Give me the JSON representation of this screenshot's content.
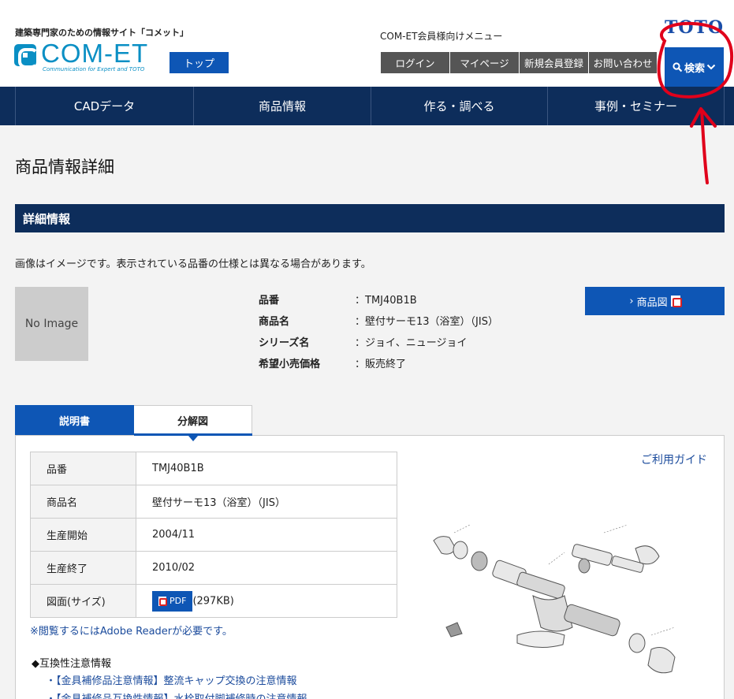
{
  "header": {
    "tagline": "建築専門家のための情報サイト「コメット」",
    "logo_text": "COM-ET",
    "logo_sub": "Communication for Expert and TOTO",
    "top_button": "トップ",
    "member_menu": "COM-ET会員様向けメニュー",
    "brand": "TOTO",
    "links": [
      "ログイン",
      "マイページ",
      "新規会員登録",
      "お問い合わせ"
    ],
    "search_label": "検索"
  },
  "nav": [
    "CADデータ",
    "商品情報",
    "作る・調べる",
    "事例・セミナー"
  ],
  "page_title": "商品情報詳細",
  "section_title": "詳細情報",
  "notice": "画像はイメージです。表示されている品番の仕様とは異なる場合があります。",
  "no_image": "No Image",
  "spec": [
    {
      "label": "品番",
      "value": "：TMJ40B1B"
    },
    {
      "label": "商品名",
      "value": "：壁付サーモ13（浴室）（JIS）"
    },
    {
      "label": "シリーズ名",
      "value": "：ジョイ、ニュージョイ"
    },
    {
      "label": "希望小売価格",
      "value": "：販売終了"
    }
  ],
  "drawing_button": "商品図",
  "tabs": {
    "manual": "説明書",
    "exploded": "分解図"
  },
  "table": [
    {
      "label": "品番",
      "value": "TMJ40B1B"
    },
    {
      "label": "商品名",
      "value": "壁付サーモ13（浴室）（JIS）"
    },
    {
      "label": "生産開始",
      "value": "2004/11"
    },
    {
      "label": "生産終了",
      "value": "2010/02"
    },
    {
      "label": "図面(サイズ)",
      "pdf": "PDF",
      "size": "(297KB)"
    }
  ],
  "adobe_note": "※閲覧するにはAdobe Readerが必要です。",
  "guide_link": "ご利用ガイド",
  "compat_title": "◆互換性注意情報",
  "compat_items": [
    "【金具補修品注意情報】整流キャップ交換の注意情報",
    "【金具補修品互換性情報】水栓取付脚補修時の注意情報"
  ],
  "colors": {
    "nav": "#0d2d5b",
    "accent": "#0e56b5",
    "annotation": "#e0001b"
  }
}
